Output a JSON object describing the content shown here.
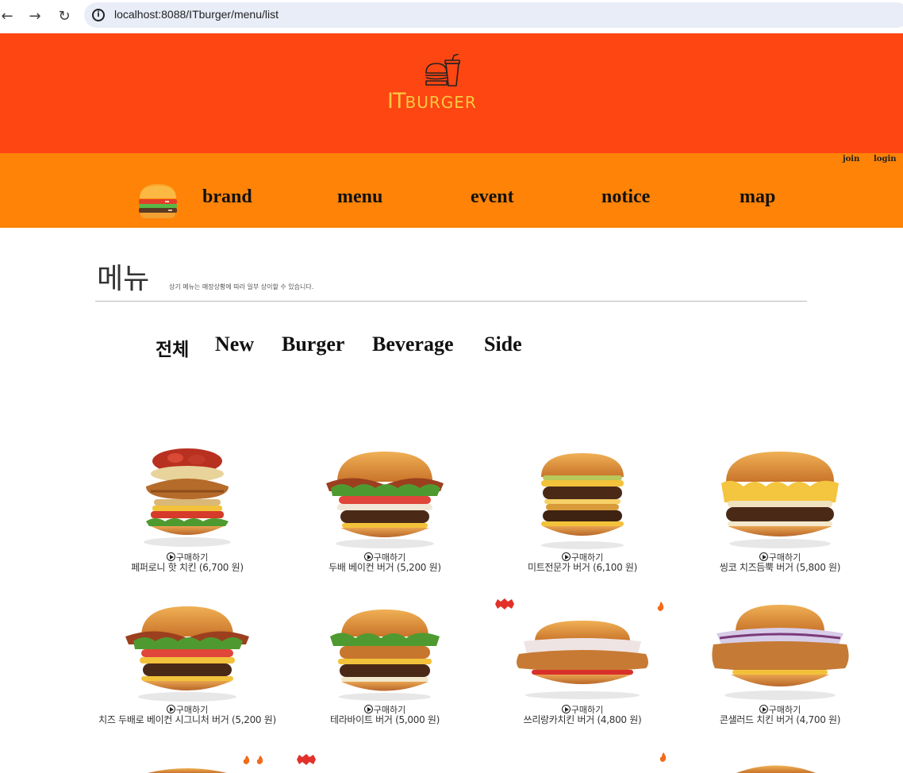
{
  "browser": {
    "url": "localhost:8088/ITburger/menu/list"
  },
  "header": {
    "logo_it": "IT",
    "logo_burger": "BURGER"
  },
  "auth": {
    "join": "join",
    "login": "login"
  },
  "nav": {
    "items": [
      "brand",
      "menu",
      "event",
      "notice",
      "map"
    ]
  },
  "page": {
    "title": "메뉴",
    "subtitle": "상기 메뉴는 매장상황에 따라 일부 상이할 수 있습니다."
  },
  "categories": [
    "전체",
    "New",
    "Burger",
    "Beverage",
    "Side"
  ],
  "buy_label": "구매하기",
  "products": [
    {
      "name": "페퍼로니 핫 치킨 (6,700 원)"
    },
    {
      "name": "두배 베이컨 버거 (5,200 원)"
    },
    {
      "name": "미트전문가 버거 (6,100 원)"
    },
    {
      "name": "씽코 치즈듬뿍 버거 (5,800 원)"
    },
    {
      "name": "치즈 두배로 베이컨 시그니처 버거 (5,200 원)"
    },
    {
      "name": "테라바이트 버거 (5,000 원)"
    },
    {
      "name": "쓰리랑카치킨 버거 (4,800 원)"
    },
    {
      "name": "콘샐러드 치킨 버거 (4,700 원)"
    }
  ],
  "colors": {
    "header_bg": "#fe4612",
    "nav_bg": "#fe8307",
    "logo": "#f9c942"
  }
}
